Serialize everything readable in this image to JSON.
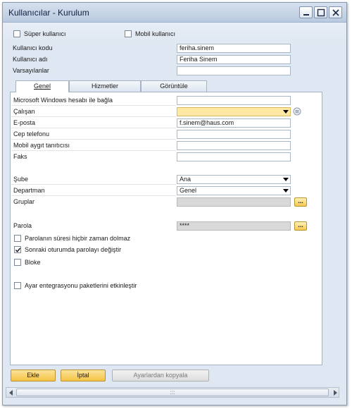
{
  "window": {
    "title": "Kullanıcılar - Kurulum"
  },
  "top": {
    "super_user_label": "Süper kullanıcı",
    "super_user_checked": false,
    "mobile_user_label": "Mobil kullanıcı",
    "mobile_user_checked": false,
    "user_code_label": "Kullanıcı kodu",
    "user_code_value": "feriha.sinem",
    "user_name_label": "Kullanıcı adı",
    "user_name_value": "Feriha Sinem",
    "defaults_label": "Varsayılanlar",
    "defaults_value": ""
  },
  "tabs": [
    {
      "label": "Genel",
      "active": true
    },
    {
      "label": "Hizmetler",
      "active": false
    },
    {
      "label": "Görüntüle",
      "active": false
    }
  ],
  "general": {
    "ms_windows_label": "Microsoft Windows hesabı ile bağla",
    "ms_windows_value": "",
    "employee_label": "Çalışan",
    "employee_value": "",
    "email_label": "E-posta",
    "email_value": "f.sinem@haus.com",
    "mobile_phone_label": "Cep telefonu",
    "mobile_phone_value": "",
    "mobile_device_label": "Mobil aygıt tanıtıcısı",
    "mobile_device_value": "",
    "fax_label": "Faks",
    "fax_value": "",
    "branch_label": "Şube",
    "branch_value": "Ana",
    "department_label": "Departman",
    "department_value": "Genel",
    "groups_label": "Gruplar",
    "groups_value": "",
    "password_label": "Parola",
    "password_value": "****",
    "pw_never_expires_label": "Parolanın süresi hiçbir zaman dolmaz",
    "pw_never_expires_checked": false,
    "change_pw_next_label": "Sonraki oturumda parolayı değiştir",
    "change_pw_next_checked": true,
    "locked_label": "Bloke",
    "locked_checked": false,
    "enable_packages_label": "Ayar entegrasyonu paketlerini etkinleştir",
    "enable_packages_checked": false
  },
  "actions": {
    "add_label": "Ekle",
    "cancel_label": "İptal",
    "copy_label": "Ayarlardan kopyala"
  },
  "scrollbar": {
    "thumb_glyph": ":::"
  },
  "icons": {
    "ellipsis": "..."
  },
  "colors": {
    "accent_button": "#f3c343",
    "mandatory_field": "#fde9a4",
    "disabled_field": "#d9d9d9"
  }
}
